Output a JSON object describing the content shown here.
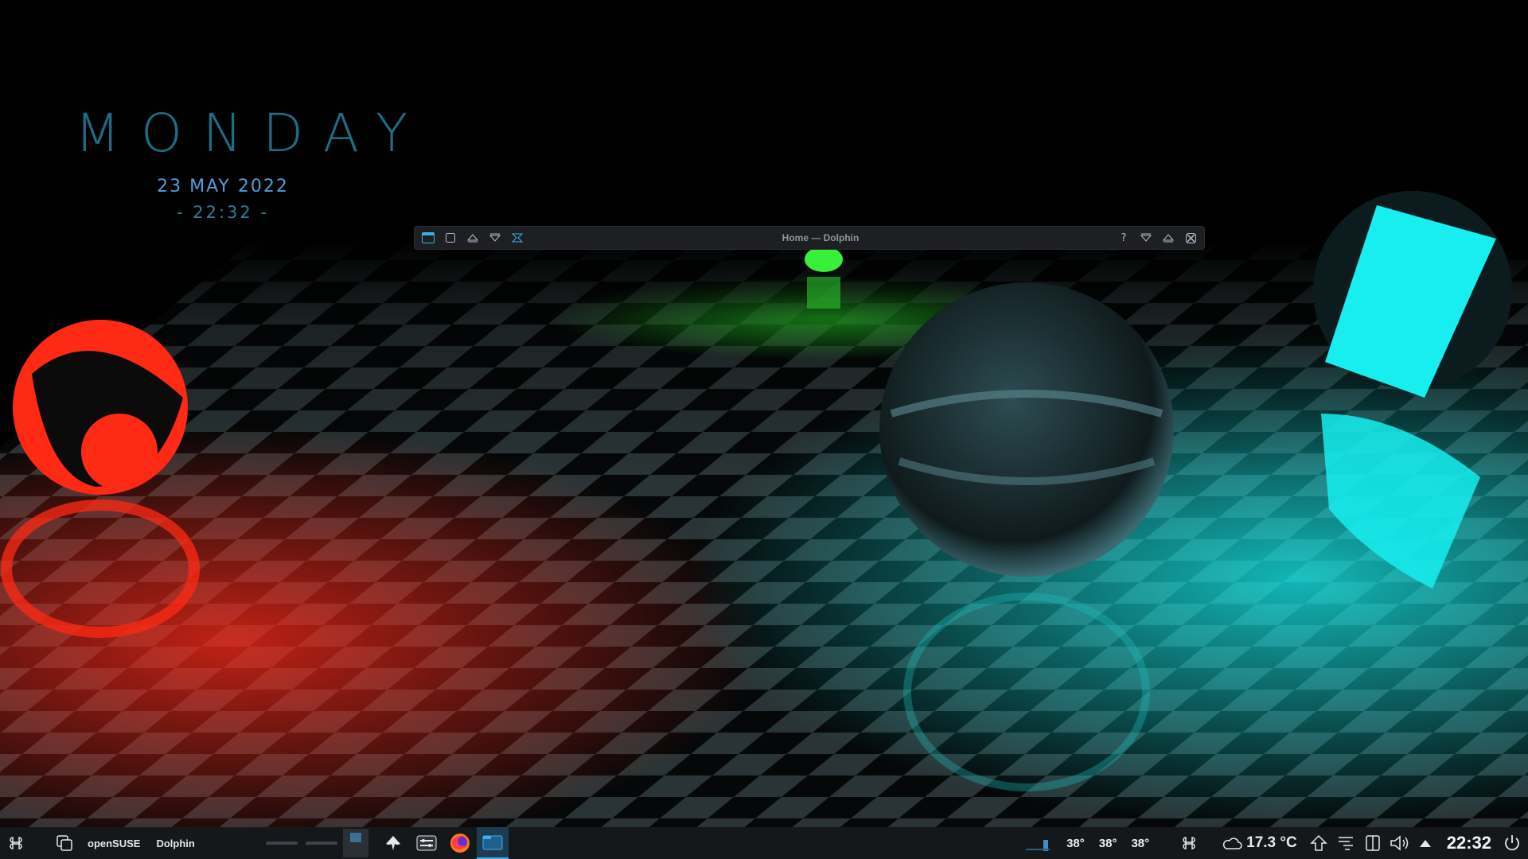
{
  "desktop_widget": {
    "day": "MONDAY",
    "date": "23 MAY 2022",
    "time": "- 22:32 -"
  },
  "window": {
    "title": "Home — Dolphin",
    "left_buttons": [
      "window-menu-icon",
      "on-all-desktops-icon",
      "keep-above-icon",
      "keep-below-icon",
      "shade-icon"
    ],
    "right_buttons": [
      "help-icon",
      "minimize-icon",
      "maximize-icon",
      "close-icon"
    ],
    "help_glyph": "?"
  },
  "taskbar": {
    "launcher_icon": "kde-launcher-icon",
    "tasks": [
      {
        "label": "openSUSE"
      },
      {
        "label": "Dolphin"
      }
    ],
    "pinned_apps": [
      "inkscape-icon",
      "settings-icon",
      "firefox-icon",
      "dolphin-icon"
    ],
    "temperatures": [
      "38°",
      "38°",
      "38°"
    ],
    "weather": "17.3 °C",
    "clock": "22:32"
  },
  "colors": {
    "accent": "#1b6e84",
    "date": "#4f9fd8",
    "panel": "#15181b",
    "active_indicator": "#3daee9"
  }
}
